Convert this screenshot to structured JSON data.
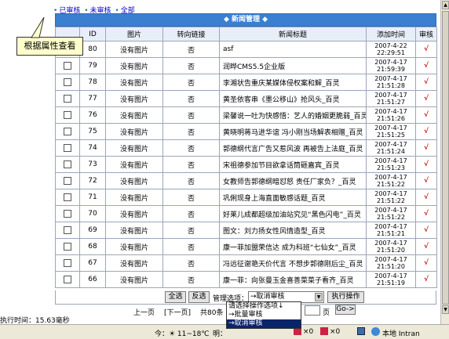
{
  "filter": {
    "audited": "已审核",
    "unaudited": "未审核",
    "all": "全部"
  },
  "tooltip": "根据属性查看",
  "panel_title": "◆ 新闻管理 ◆",
  "columns": [
    "",
    "ID",
    "图片",
    "转向链接",
    "新闻标题",
    "添加时间",
    "审核"
  ],
  "rows": [
    {
      "id": "80",
      "pic": "没有图片",
      "link": "否",
      "title": "asf",
      "time": "2007-4-22 22:29:51",
      "check": "√"
    },
    {
      "id": "79",
      "pic": "没有图片",
      "link": "否",
      "title": "润晔CMS5.5企业版",
      "time": "2007-4-17 21:59:39",
      "check": "√"
    },
    {
      "id": "78",
      "pic": "没有图片",
      "link": "否",
      "title": "李湘状告重庆某媒体侵权案和解_百灵",
      "time": "2007-4-17 21:51:28",
      "check": "√"
    },
    {
      "id": "77",
      "pic": "没有图片",
      "link": "否",
      "title": "黄圣依客串《墨公移山》抢风头_百灵",
      "time": "2007-4-17 21:51:27",
      "check": "√"
    },
    {
      "id": "76",
      "pic": "没有图片",
      "link": "否",
      "title": "梁馨说一吐为快感悟：艺人的婚姻更脆弱_百灵",
      "time": "2007-4-17 21:51:26",
      "check": "√"
    },
    {
      "id": "75",
      "pic": "没有图片",
      "link": "否",
      "title": "黄晓明蒋马进华谊 冯小刚当场解表相赠_百灵",
      "time": "2007-4-17 21:51:25",
      "check": "√"
    },
    {
      "id": "74",
      "pic": "没有图片",
      "link": "否",
      "title": "郭德纲代言广告又惹风波 再被告上法庭_百灵",
      "time": "2007-4-17 21:51:24",
      "check": "√"
    },
    {
      "id": "73",
      "pic": "没有图片",
      "link": "否",
      "title": "宋祖德参加节目欲拿话筒砸嘉宾_百灵",
      "time": "2007-4-17 21:51:23",
      "check": "√"
    },
    {
      "id": "72",
      "pic": "没有图片",
      "link": "否",
      "title": "女教师告郭德纲暗怼怒 责任厂家负？_百灵",
      "time": "2007-4-17 21:51:22",
      "check": "√"
    },
    {
      "id": "71",
      "pic": "没有图片",
      "link": "否",
      "title": "巩俐现身上海直面敏感话题_百灵",
      "time": "2007-4-17 21:51:22",
      "check": "√"
    },
    {
      "id": "70",
      "pic": "没有图片",
      "link": "否",
      "title": "好莱儿成都超级加油站究见“黑色闪电”_百灵",
      "time": "2007-4-17 21:51:22",
      "check": "√"
    },
    {
      "id": "69",
      "pic": "没有图片",
      "link": "否",
      "title": "图文：刘力扬女性风情造型_百灵",
      "time": "2007-4-17 21:51:21",
      "check": "√"
    },
    {
      "id": "68",
      "pic": "没有图片",
      "link": "否",
      "title": "康一菲加盟荣信达 成为科班“七仙女”_百灵",
      "time": "2007-4-17 21:51:20",
      "check": "√"
    },
    {
      "id": "67",
      "pic": "没有图片",
      "link": "否",
      "title": "冯远征谢艳天价代言 不想步郭德刚后尘_百灵",
      "time": "2007-4-17 21:51:20",
      "check": "√"
    },
    {
      "id": "66",
      "pic": "没有图片",
      "link": "否",
      "title": "康一菲：向张曼玉金喜善菜菜子看齐_百灵",
      "time": "2007-4-17 21:51:19",
      "check": "√"
    }
  ],
  "actions": {
    "select_all": "全选",
    "invert": "反选",
    "manage_label": "管理选项：",
    "select_value": "→取消审核",
    "execute": "执行操作"
  },
  "pager": {
    "prev": "上一页",
    "next": "[下一页]",
    "info": "共80条",
    "page": "页",
    "go": "Go->"
  },
  "dropdown": [
    "请选择操作选项↓",
    "→批量审核",
    "→取消审核"
  ],
  "exec_time": "执行时间：15.63毫秒",
  "status": {
    "weather": "今：☀ 11~18℃",
    "mid": "明：",
    "count1": "×0",
    "count2": "×0",
    "zone": "本地 Intran"
  }
}
